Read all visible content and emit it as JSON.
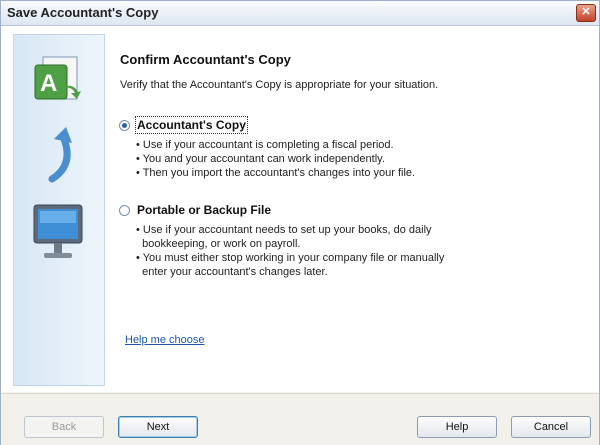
{
  "window": {
    "title": "Save Accountant's Copy",
    "close_label": "✕"
  },
  "header": {
    "title": "Confirm Accountant's Copy",
    "subtitle": "Verify that the Accountant's Copy is appropriate for your situation."
  },
  "options": [
    {
      "label": "Accountant's Copy",
      "selected": true,
      "bullets": [
        "• Use if your accountant is completing a fiscal period.",
        "• You and your accountant can work independently.",
        "• Then you import the accountant's changes into your file."
      ]
    },
    {
      "label": "Portable or Backup File",
      "selected": false,
      "bullets": [
        "• Use if your accountant needs to set up your books, do daily",
        "  bookkeeping, or work on payroll.",
        "• You must either stop working in your company file or manually",
        "  enter your accountant's changes later."
      ]
    }
  ],
  "help_link": "Help me choose",
  "buttons": {
    "back": "Back",
    "next": "Next",
    "help": "Help",
    "cancel": "Cancel"
  },
  "icons": [
    "document-letter-a-icon",
    "curved-arrow-icon",
    "computer-monitor-icon"
  ]
}
